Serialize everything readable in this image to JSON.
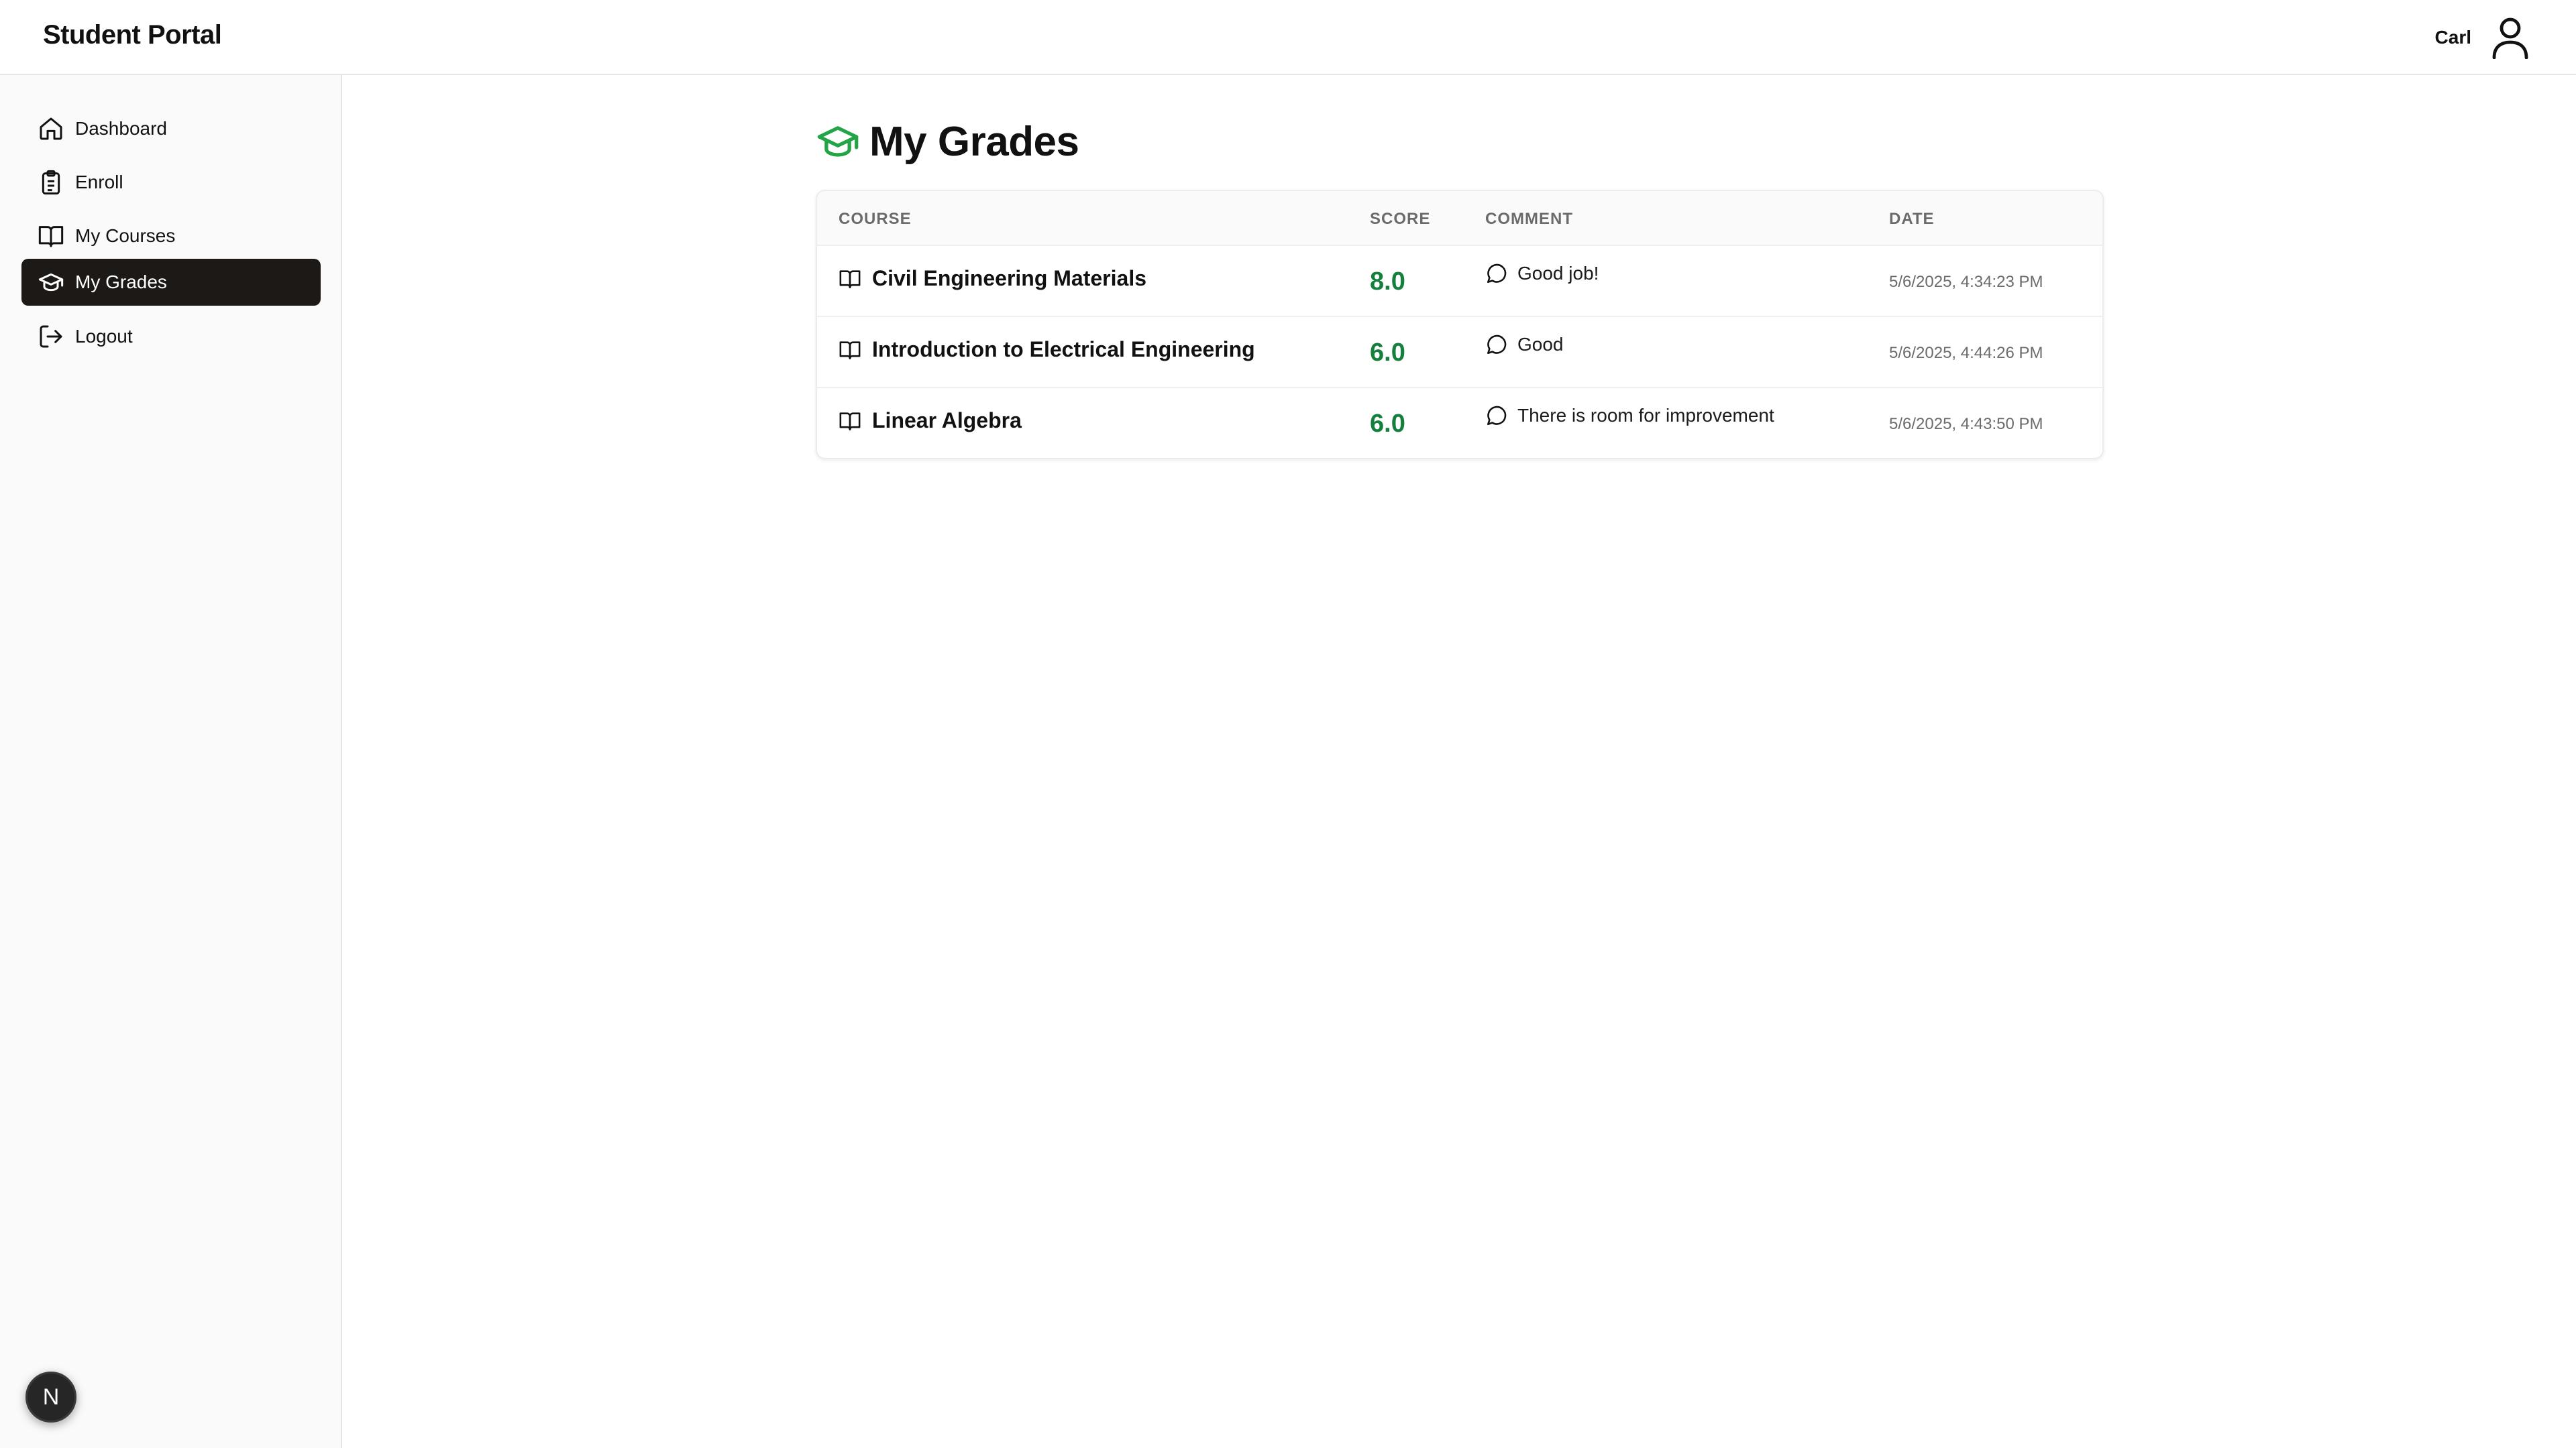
{
  "header": {
    "brand": "Student Portal",
    "user_name": "Carl",
    "user_icon": "user-icon"
  },
  "sidebar": {
    "items": [
      {
        "label": "Dashboard",
        "icon": "home-icon",
        "active": false
      },
      {
        "label": "Enroll",
        "icon": "clipboard-icon",
        "active": false
      },
      {
        "label": "My Courses",
        "icon": "book-open-icon",
        "active": false
      },
      {
        "label": "My Grades",
        "icon": "graduation-cap-icon",
        "active": true
      },
      {
        "label": "Logout",
        "icon": "logout-icon",
        "active": false
      }
    ],
    "badge": "N"
  },
  "main": {
    "title": "My Grades",
    "title_icon": "graduation-cap-icon",
    "table": {
      "columns": [
        "COURSE",
        "SCORE",
        "COMMENT",
        "DATE"
      ],
      "rows": [
        {
          "course": "Civil Engineering Materials",
          "score": "8.0",
          "comment": "Good job!",
          "date": "5/6/2025, 4:34:23 PM"
        },
        {
          "course": "Introduction to Electrical Engineering",
          "score": "6.0",
          "comment": "Good",
          "date": "5/6/2025, 4:44:26 PM"
        },
        {
          "course": "Linear Algebra",
          "score": "6.0",
          "comment": "There is room for improvement",
          "date": "5/6/2025, 4:43:50 PM"
        }
      ]
    }
  },
  "colors": {
    "accent_green": "#15803d",
    "title_icon_green": "#22a447",
    "active_nav_bg": "#1c1917"
  }
}
